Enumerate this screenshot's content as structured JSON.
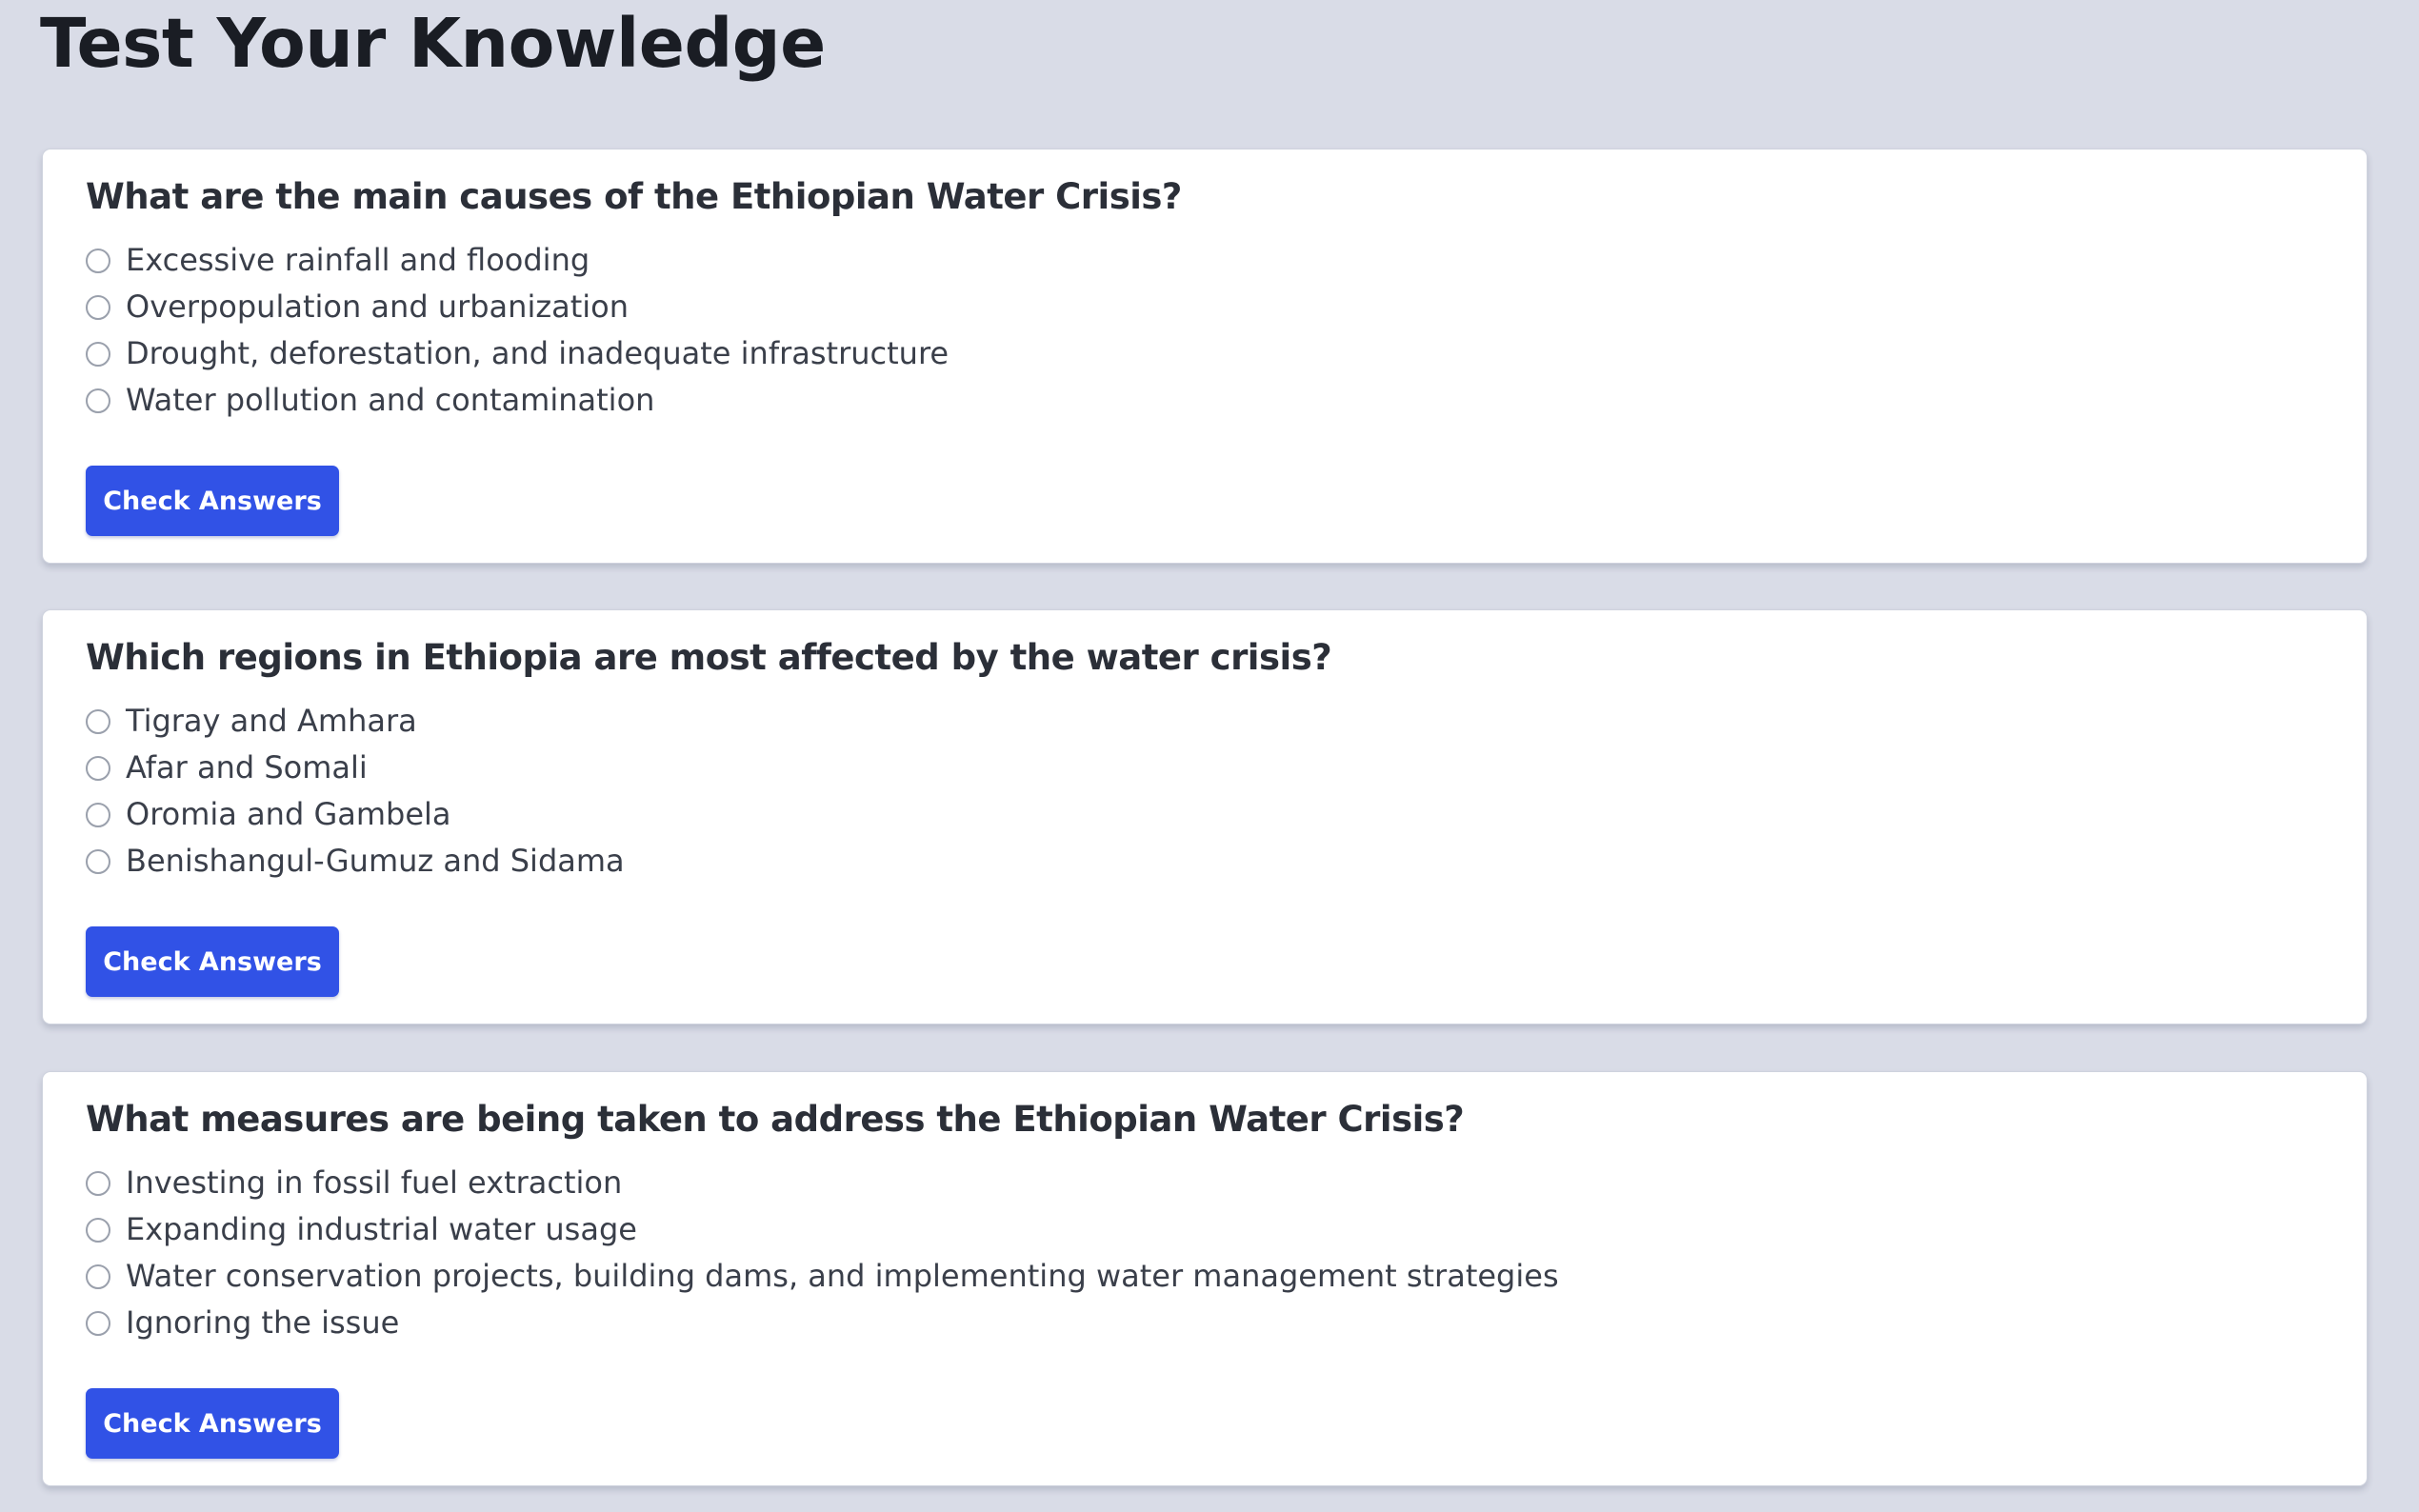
{
  "page": {
    "title": "Test Your Knowledge"
  },
  "questions": [
    {
      "question": "What are the main causes of the Ethiopian Water Crisis?",
      "options": [
        "Excessive rainfall and flooding",
        "Overpopulation and urbanization",
        "Drought, deforestation, and inadequate infrastructure",
        "Water pollution and contamination"
      ],
      "button_label": "Check Answers"
    },
    {
      "question": "Which regions in Ethiopia are most affected by the water crisis?",
      "options": [
        "Tigray and Amhara",
        "Afar and Somali",
        "Oromia and Gambela",
        "Benishangul-Gumuz and Sidama"
      ],
      "button_label": "Check Answers"
    },
    {
      "question": "What measures are being taken to address the Ethiopian Water Crisis?",
      "options": [
        "Investing in fossil fuel extraction",
        "Expanding industrial water usage",
        "Water conservation projects, building dams, and implementing water management strategies",
        "Ignoring the issue"
      ],
      "button_label": "Check Answers"
    }
  ],
  "colors": {
    "page_background": "#d9dce7",
    "card_background": "#ffffff",
    "button_background": "#3152e6",
    "title_text": "#1a1d24"
  }
}
